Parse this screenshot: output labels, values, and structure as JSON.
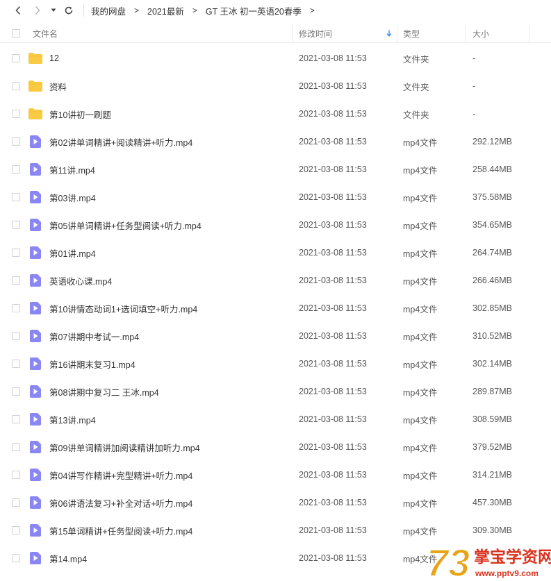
{
  "toolbar": {
    "back_icon": "chevron-left-icon",
    "forward_icon": "chevron-right-icon",
    "dropdown_icon": "caret-down-icon",
    "refresh_icon": "refresh-icon",
    "breadcrumbs": [
      {
        "label": "我的网盘"
      },
      {
        "label": "2021最新"
      },
      {
        "label": "GT 王冰 初一英语20春季"
      }
    ],
    "separator": ">"
  },
  "columns": {
    "name": "文件名",
    "modified": "修改时间",
    "type": "类型",
    "size": "大小",
    "sort_icon": "sort-down-arrow-icon"
  },
  "colors": {
    "folder": "#F9CB45",
    "video": "#8A87F5",
    "sort_arrow": "#3B8CF5"
  },
  "files": [
    {
      "name": "12",
      "modified": "2021-03-08 11:53",
      "type": "文件夹",
      "size": "-",
      "icon": "folder-icon"
    },
    {
      "name": "资料",
      "modified": "2021-03-08 11:53",
      "type": "文件夹",
      "size": "-",
      "icon": "folder-icon"
    },
    {
      "name": "第10讲初一刷题",
      "modified": "2021-03-08 11:53",
      "type": "文件夹",
      "size": "-",
      "icon": "folder-icon"
    },
    {
      "name": "第02讲单词精讲+阅读精讲+听力.mp4",
      "modified": "2021-03-08 11:53",
      "type": "mp4文件",
      "size": "292.12MB",
      "icon": "video-file-icon"
    },
    {
      "name": "第11讲.mp4",
      "modified": "2021-03-08 11:53",
      "type": "mp4文件",
      "size": "258.44MB",
      "icon": "video-file-icon"
    },
    {
      "name": "第03讲.mp4",
      "modified": "2021-03-08 11:53",
      "type": "mp4文件",
      "size": "375.58MB",
      "icon": "video-file-icon"
    },
    {
      "name": "第05讲单词精讲+任务型阅读+听力.mp4",
      "modified": "2021-03-08 11:53",
      "type": "mp4文件",
      "size": "354.65MB",
      "icon": "video-file-icon"
    },
    {
      "name": "第01讲.mp4",
      "modified": "2021-03-08 11:53",
      "type": "mp4文件",
      "size": "264.74MB",
      "icon": "video-file-icon"
    },
    {
      "name": "英语收心课.mp4",
      "modified": "2021-03-08 11:53",
      "type": "mp4文件",
      "size": "266.46MB",
      "icon": "video-file-icon"
    },
    {
      "name": "第10讲情态动词1+选词填空+听力.mp4",
      "modified": "2021-03-08 11:53",
      "type": "mp4文件",
      "size": "302.85MB",
      "icon": "video-file-icon"
    },
    {
      "name": "第07讲期中考试一.mp4",
      "modified": "2021-03-08 11:53",
      "type": "mp4文件",
      "size": "310.52MB",
      "icon": "video-file-icon"
    },
    {
      "name": "第16讲期末复习1.mp4",
      "modified": "2021-03-08 11:53",
      "type": "mp4文件",
      "size": "302.14MB",
      "icon": "video-file-icon"
    },
    {
      "name": "第08讲期中复习二 王冰.mp4",
      "modified": "2021-03-08 11:53",
      "type": "mp4文件",
      "size": "289.87MB",
      "icon": "video-file-icon"
    },
    {
      "name": "第13讲.mp4",
      "modified": "2021-03-08 11:53",
      "type": "mp4文件",
      "size": "308.59MB",
      "icon": "video-file-icon"
    },
    {
      "name": "第09讲单词精讲加阅读精讲加听力.mp4",
      "modified": "2021-03-08 11:53",
      "type": "mp4文件",
      "size": "379.52MB",
      "icon": "video-file-icon"
    },
    {
      "name": "第04讲写作精讲+完型精讲+听力.mp4",
      "modified": "2021-03-08 11:53",
      "type": "mp4文件",
      "size": "314.21MB",
      "icon": "video-file-icon"
    },
    {
      "name": "第06讲语法复习+补全对话+听力.mp4",
      "modified": "2021-03-08 11:53",
      "type": "mp4文件",
      "size": "457.30MB",
      "icon": "video-file-icon"
    },
    {
      "name": "第15单词精讲+任务型阅读+听力.mp4",
      "modified": "2021-03-08 11:53",
      "type": "mp4文件",
      "size": "309.30MB",
      "icon": "video-file-icon"
    },
    {
      "name": "第14.mp4",
      "modified": "2021-03-08 11:53",
      "type": "mp4文件",
      "size": "",
      "icon": "video-file-icon"
    }
  ],
  "watermark": {
    "logo_text": "73",
    "brand": "掌宝学资网",
    "url": "www.pptv9.com"
  }
}
